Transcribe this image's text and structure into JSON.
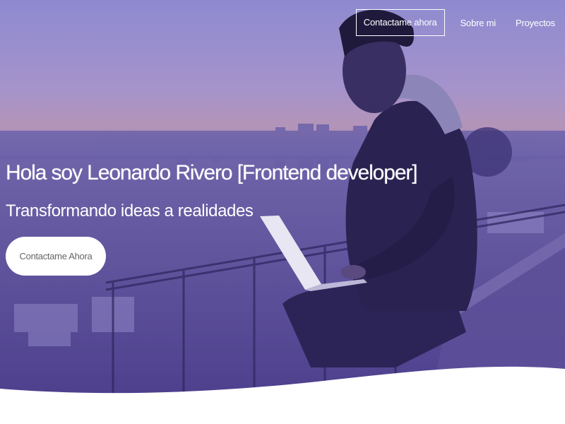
{
  "nav": {
    "cta_label": "Contactame ahora",
    "items": [
      {
        "label": "Sobre mi"
      },
      {
        "label": "Proyectos"
      }
    ]
  },
  "hero": {
    "headline": "Hola soy Leonardo Rivero [Frontend developer]",
    "subheadline": "Transformando ideas a realidades",
    "cta_label": "Contactame Ahora",
    "background_image": "man-with-laptop-city-view",
    "overlay_color": "#4b3b86"
  }
}
